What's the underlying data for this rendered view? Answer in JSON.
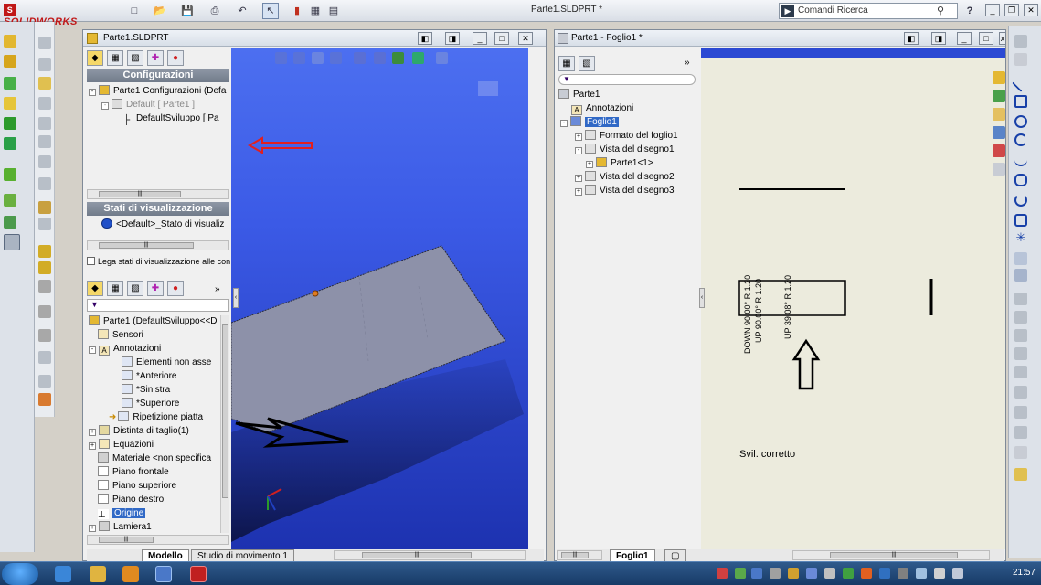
{
  "app": {
    "name": "SOLIDWORKS",
    "document_title": "Parte1.SLDPRT *"
  },
  "search": {
    "label": "Comandi Ricerca"
  },
  "left_window": {
    "title": "Parte1.SLDPRT",
    "config_header": "Configurazioni",
    "config_tree": [
      "Parte1 Configurazioni  (Defa",
      "Default [ Parte1 ]",
      "DefaultSviluppo [ Pa"
    ],
    "display_states_header": "Stati di visualizzazione",
    "display_state": "<Default>_Stato di visualiz",
    "link_display_states": "Lega stati di visualizzazione alle con",
    "feature_tree": [
      "Parte1  (DefaultSviluppo<<D",
      "Sensori",
      "Annotazioni",
      "Elementi non asse",
      "*Anteriore",
      "*Sinistra",
      "*Superiore",
      "Ripetizione piatta",
      "Distinta di taglio(1)",
      "Equazioni",
      "Materiale <non specifica",
      "Piano frontale",
      "Piano superiore",
      "Piano destro",
      "Origine",
      "Lamiera1"
    ],
    "bottom_tabs": [
      "Modello",
      "Studio di movimento 1"
    ]
  },
  "right_window": {
    "title": "Parte1 - Foglio1 *",
    "tree": [
      "Parte1",
      "Annotazioni",
      "Foglio1",
      "Formato del foglio1",
      "Vista del disegno1",
      "Parte1<1>",
      "Vista del disegno2",
      "Vista del disegno3"
    ],
    "sheet_tab": "Foglio1",
    "annotations": {
      "bend1": "DOWN  90.00°  R 1.20",
      "bend2": "UP  90.00°  R 1.20",
      "bend3": "UP  39.08°  R 1.20",
      "note": "Svil. corretto"
    }
  },
  "taskbar": {
    "clock": "21:57"
  },
  "colors": {
    "viewport_top": "#4c6ff0",
    "viewport_bottom": "#1d32b0",
    "sheet": "#ecebdd",
    "red_arrow": "#e02020"
  }
}
